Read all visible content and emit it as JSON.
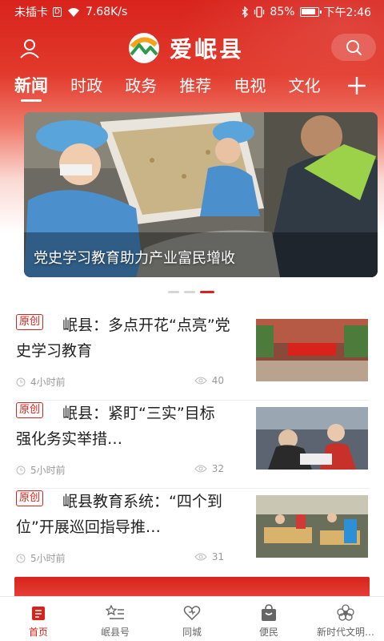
{
  "status_bar": {
    "carrier": "未插卡",
    "sim_badge": "D",
    "speed": "7.68K/s",
    "battery": "85%",
    "time": "下午2:46"
  },
  "header": {
    "app_title": "爱岷县"
  },
  "tabs": [
    {
      "label": "新闻",
      "active": true
    },
    {
      "label": "时政",
      "active": false
    },
    {
      "label": "政务",
      "active": false
    },
    {
      "label": "推荐",
      "active": false
    },
    {
      "label": "电视",
      "active": false
    },
    {
      "label": "文化",
      "active": false
    }
  ],
  "banner": {
    "caption": "党史学习教育助力产业富民增收",
    "slide_count": 3,
    "active_slide": 3
  },
  "news": [
    {
      "tag": "原创",
      "title": "岷县：多点开花“点亮”党史学习教育",
      "time": "4小时前",
      "views": "40"
    },
    {
      "tag": "原创",
      "title": "岷县：紧盯“三实”目标 强化务实举措…",
      "time": "5小时前",
      "views": "32"
    },
    {
      "tag": "原创",
      "title": "岷县教育系统：“四个到位”开展巡回指导推…",
      "time": "5小时前",
      "views": "31"
    }
  ],
  "bottom_nav": [
    {
      "label": "首页",
      "icon": "home-icon",
      "active": true
    },
    {
      "label": "岷县号",
      "icon": "star-list-icon",
      "active": false
    },
    {
      "label": "同城",
      "icon": "heart-icon",
      "active": false
    },
    {
      "label": "便民",
      "icon": "bag-icon",
      "active": false
    },
    {
      "label": "新时代文明…",
      "icon": "flower-icon",
      "active": false
    }
  ],
  "colors": {
    "brand_red": "#d8231c",
    "text_dark": "#222222",
    "text_meta": "#999999"
  }
}
